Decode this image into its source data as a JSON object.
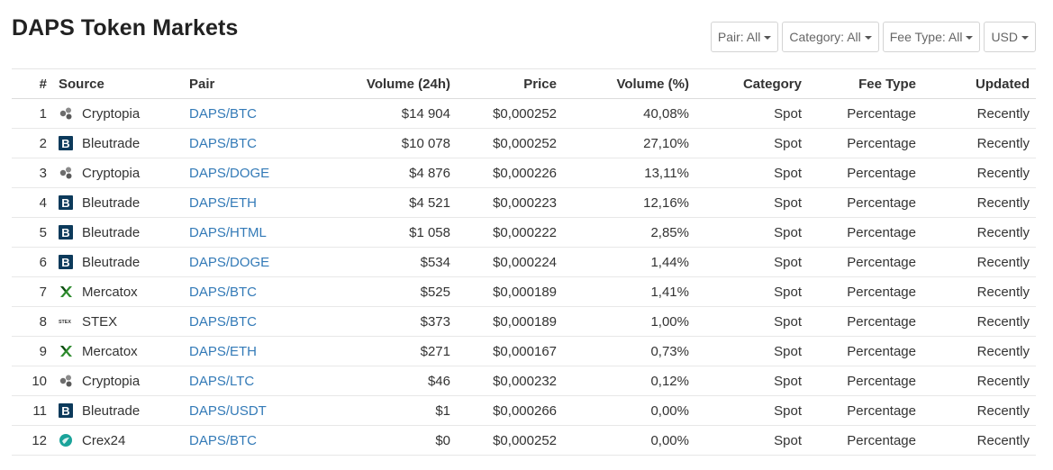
{
  "page": {
    "title": "DAPS Token Markets"
  },
  "filters": [
    {
      "name": "pair-filter",
      "label": "Pair: All"
    },
    {
      "name": "category-filter",
      "label": "Category: All"
    },
    {
      "name": "fee-type-filter",
      "label": "Fee Type: All"
    },
    {
      "name": "currency-filter",
      "label": "USD"
    }
  ],
  "table": {
    "headers": {
      "num": "#",
      "source": "Source",
      "pair": "Pair",
      "volume": "Volume (24h)",
      "price": "Price",
      "volume_pct": "Volume (%)",
      "category": "Category",
      "fee_type": "Fee Type",
      "updated": "Updated"
    },
    "rows": [
      {
        "num": "1",
        "source": "Cryptopia",
        "logo": "cryptopia-icon",
        "pair": "DAPS/BTC",
        "volume": "$14 904",
        "price": "$0,000252",
        "volume_pct": "40,08%",
        "category": "Spot",
        "fee_type": "Percentage",
        "updated": "Recently"
      },
      {
        "num": "2",
        "source": "Bleutrade",
        "logo": "bleutrade-icon",
        "pair": "DAPS/BTC",
        "volume": "$10 078",
        "price": "$0,000252",
        "volume_pct": "27,10%",
        "category": "Spot",
        "fee_type": "Percentage",
        "updated": "Recently"
      },
      {
        "num": "3",
        "source": "Cryptopia",
        "logo": "cryptopia-icon",
        "pair": "DAPS/DOGE",
        "volume": "$4 876",
        "price": "$0,000226",
        "volume_pct": "13,11%",
        "category": "Spot",
        "fee_type": "Percentage",
        "updated": "Recently"
      },
      {
        "num": "4",
        "source": "Bleutrade",
        "logo": "bleutrade-icon",
        "pair": "DAPS/ETH",
        "volume": "$4 521",
        "price": "$0,000223",
        "volume_pct": "12,16%",
        "category": "Spot",
        "fee_type": "Percentage",
        "updated": "Recently"
      },
      {
        "num": "5",
        "source": "Bleutrade",
        "logo": "bleutrade-icon",
        "pair": "DAPS/HTML",
        "volume": "$1 058",
        "price": "$0,000222",
        "volume_pct": "2,85%",
        "category": "Spot",
        "fee_type": "Percentage",
        "updated": "Recently"
      },
      {
        "num": "6",
        "source": "Bleutrade",
        "logo": "bleutrade-icon",
        "pair": "DAPS/DOGE",
        "volume": "$534",
        "price": "$0,000224",
        "volume_pct": "1,44%",
        "category": "Spot",
        "fee_type": "Percentage",
        "updated": "Recently"
      },
      {
        "num": "7",
        "source": "Mercatox",
        "logo": "mercatox-icon",
        "pair": "DAPS/BTC",
        "volume": "$525",
        "price": "$0,000189",
        "volume_pct": "1,41%",
        "category": "Spot",
        "fee_type": "Percentage",
        "updated": "Recently"
      },
      {
        "num": "8",
        "source": "STEX",
        "logo": "stex-icon",
        "pair": "DAPS/BTC",
        "volume": "$373",
        "price": "$0,000189",
        "volume_pct": "1,00%",
        "category": "Spot",
        "fee_type": "Percentage",
        "updated": "Recently"
      },
      {
        "num": "9",
        "source": "Mercatox",
        "logo": "mercatox-icon",
        "pair": "DAPS/ETH",
        "volume": "$271",
        "price": "$0,000167",
        "volume_pct": "0,73%",
        "category": "Spot",
        "fee_type": "Percentage",
        "updated": "Recently"
      },
      {
        "num": "10",
        "source": "Cryptopia",
        "logo": "cryptopia-icon",
        "pair": "DAPS/LTC",
        "volume": "$46",
        "price": "$0,000232",
        "volume_pct": "0,12%",
        "category": "Spot",
        "fee_type": "Percentage",
        "updated": "Recently"
      },
      {
        "num": "11",
        "source": "Bleutrade",
        "logo": "bleutrade-icon",
        "pair": "DAPS/USDT",
        "volume": "$1",
        "price": "$0,000266",
        "volume_pct": "0,00%",
        "category": "Spot",
        "fee_type": "Percentage",
        "updated": "Recently"
      },
      {
        "num": "12",
        "source": "Crex24",
        "logo": "crex24-icon",
        "pair": "DAPS/BTC",
        "volume": "$0",
        "price": "$0,000252",
        "volume_pct": "0,00%",
        "category": "Spot",
        "fee_type": "Percentage",
        "updated": "Recently"
      }
    ]
  },
  "colors": {
    "link": "#337ab7",
    "bleutrade": "#0c3a5b",
    "mercatox": "#2e8b2e",
    "crex24": "#1aa39a"
  }
}
